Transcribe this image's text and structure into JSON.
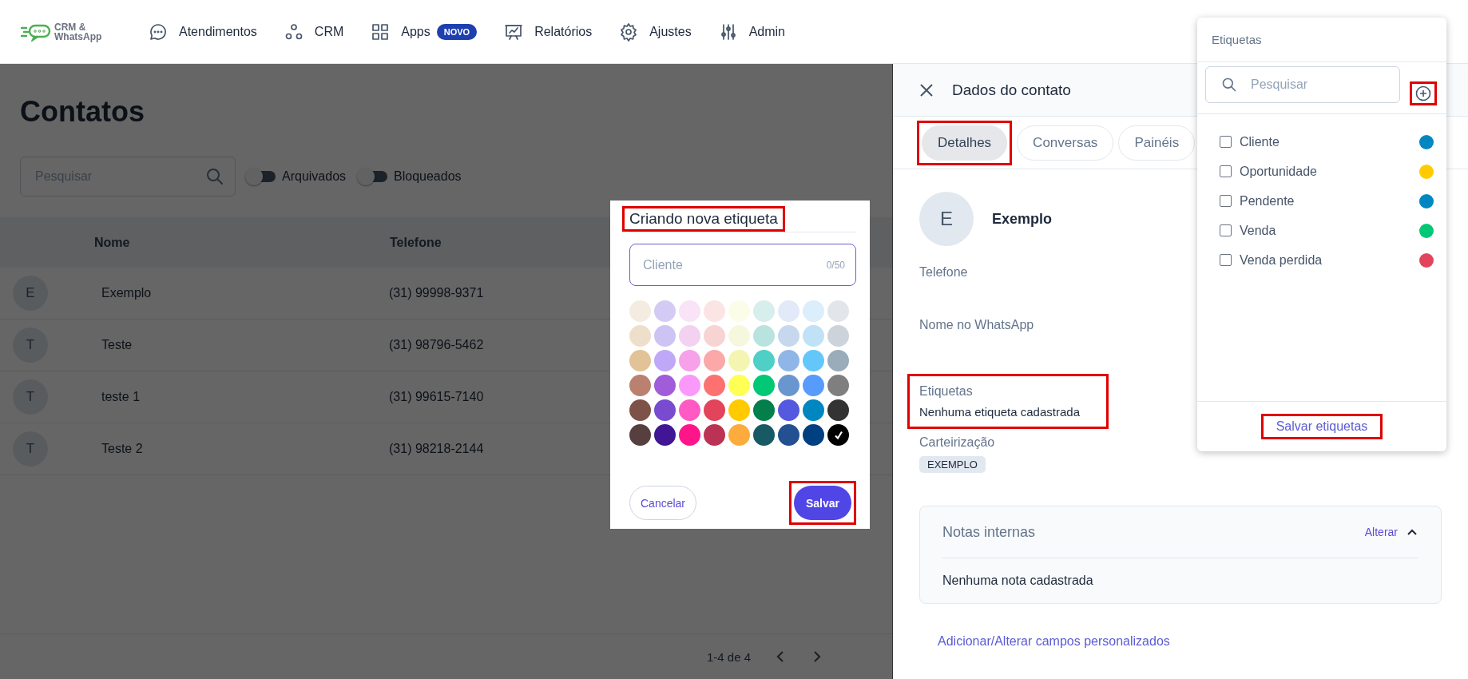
{
  "brand": {
    "logo_text": "CRM & WhatsApp"
  },
  "nav": [
    {
      "kind": "chat",
      "label": "Atendimentos"
    },
    {
      "kind": "circles",
      "label": "CRM"
    },
    {
      "kind": "grid",
      "label": "Apps",
      "badge": "NOVO"
    },
    {
      "kind": "presentation",
      "label": "Relatórios"
    },
    {
      "kind": "gear",
      "label": "Ajustes"
    },
    {
      "kind": "sliders",
      "label": "Admin"
    }
  ],
  "page": {
    "title": "Contatos",
    "search": {
      "placeholder": "Pesquisar"
    },
    "filters": [
      {
        "label": "Arquivados",
        "on": false
      },
      {
        "label": "Bloqueados",
        "on": false
      }
    ],
    "table": {
      "columns": [
        "Nome",
        "Telefone"
      ],
      "rows": [
        {
          "initial": "E",
          "name": "Exemplo",
          "phone": "(31) 99998-9371"
        },
        {
          "initial": "T",
          "name": "Teste",
          "phone": "(31) 98796-5462"
        },
        {
          "initial": "T",
          "name": "teste 1",
          "phone": "(31) 99615-7140"
        },
        {
          "initial": "T",
          "name": "Teste 2",
          "phone": "(31) 98218-2144"
        }
      ]
    },
    "pagination": {
      "range": "1-4 de 4"
    }
  },
  "drawer": {
    "title": "Dados do contato",
    "tabs": [
      {
        "label": "Detalhes",
        "selected": true,
        "highlighted": true
      },
      {
        "label": "Conversas",
        "selected": false,
        "highlighted": false
      },
      {
        "label": "Painéis",
        "selected": false,
        "highlighted": false
      }
    ],
    "contact": {
      "initial": "E",
      "name": "Exemplo"
    },
    "fields": [
      {
        "label": "Telefone",
        "highlighted": false
      },
      {
        "label": "Nome no WhatsApp",
        "highlighted": false
      },
      {
        "label": "Etiquetas",
        "value": "Nenhuma etiqueta cadastrada",
        "highlighted": true
      },
      {
        "label": "Carteirização",
        "chip": "EXEMPLO",
        "highlighted": false
      }
    ],
    "notes": {
      "title": "Notas internas",
      "action": "Alterar",
      "expanded": true,
      "empty_text": "Nenhuma nota cadastrada"
    },
    "custom_fields_link": "Adicionar/Alterar campos personalizados"
  },
  "modal": {
    "title": "Criando nova etiqueta",
    "title_highlighted": true,
    "name_field": {
      "placeholder": "Cliente",
      "counter": "0/50"
    },
    "swatches": [
      {
        "color": "#f4ece1",
        "selected": false
      },
      {
        "color": "#d4cbf5",
        "selected": false
      },
      {
        "color": "#f8e3f7",
        "selected": false
      },
      {
        "color": "#fbe4e4",
        "selected": false
      },
      {
        "color": "#fbfde8",
        "selected": false
      },
      {
        "color": "#d6eeec",
        "selected": false
      },
      {
        "color": "#e2e9f8",
        "selected": false
      },
      {
        "color": "#dcedfb",
        "selected": false
      },
      {
        "color": "#e2e6ea",
        "selected": false
      },
      {
        "color": "#eedfcb",
        "selected": false
      },
      {
        "color": "#cdc4f4",
        "selected": false
      },
      {
        "color": "#f3d1f0",
        "selected": false
      },
      {
        "color": "#f7d3d3",
        "selected": false
      },
      {
        "color": "#f6f8de",
        "selected": false
      },
      {
        "color": "#b9e3df",
        "selected": false
      },
      {
        "color": "#c7d7ee",
        "selected": false
      },
      {
        "color": "#bfe2f7",
        "selected": false
      },
      {
        "color": "#cdd3db",
        "selected": false
      },
      {
        "color": "#e2c297",
        "selected": false
      },
      {
        "color": "#bfa8f8",
        "selected": false
      },
      {
        "color": "#f6a1ea",
        "selected": false
      },
      {
        "color": "#fba8a8",
        "selected": false
      },
      {
        "color": "#f4f5b0",
        "selected": false
      },
      {
        "color": "#4fcfc6",
        "selected": false
      },
      {
        "color": "#8fb6e7",
        "selected": false
      },
      {
        "color": "#64c7fb",
        "selected": false
      },
      {
        "color": "#9aabb9",
        "selected": false
      },
      {
        "color": "#bb8170",
        "selected": false
      },
      {
        "color": "#a05cd9",
        "selected": false
      },
      {
        "color": "#fb99fb",
        "selected": false
      },
      {
        "color": "#fd7171",
        "selected": false
      },
      {
        "color": "#ffff55",
        "selected": false
      },
      {
        "color": "#00c875",
        "selected": false
      },
      {
        "color": "#6a96d0",
        "selected": false
      },
      {
        "color": "#579bfc",
        "selected": false
      },
      {
        "color": "#7f7f7f",
        "selected": false
      },
      {
        "color": "#7d5249",
        "selected": false
      },
      {
        "color": "#784bd1",
        "selected": false
      },
      {
        "color": "#ff5ac4",
        "selected": false
      },
      {
        "color": "#e2445c",
        "selected": false
      },
      {
        "color": "#ffcb00",
        "selected": false
      },
      {
        "color": "#037f4c",
        "selected": false
      },
      {
        "color": "#5559df",
        "selected": false
      },
      {
        "color": "#0086c0",
        "selected": false
      },
      {
        "color": "#333333",
        "selected": false
      },
      {
        "color": "#573f3f",
        "selected": false
      },
      {
        "color": "#401694",
        "selected": false
      },
      {
        "color": "#ff158a",
        "selected": false
      },
      {
        "color": "#bb3354",
        "selected": false
      },
      {
        "color": "#fdab3d",
        "selected": false
      },
      {
        "color": "#175a63",
        "selected": false
      },
      {
        "color": "#225091",
        "selected": false
      },
      {
        "color": "#003f80",
        "selected": false
      },
      {
        "color": "#000000",
        "selected": true
      }
    ],
    "buttons": [
      {
        "kind": "secondary",
        "label": "Cancelar",
        "highlighted": false
      },
      {
        "kind": "primary",
        "label": "Salvar",
        "highlighted": true
      }
    ]
  },
  "tag_menu": {
    "title": "Etiquetas",
    "search": {
      "placeholder": "Pesquisar"
    },
    "add_highlighted": true,
    "tags": [
      {
        "label": "Cliente",
        "checked": false,
        "color": "#0086c0"
      },
      {
        "label": "Oportunidade",
        "checked": false,
        "color": "#ffcb00"
      },
      {
        "label": "Pendente",
        "checked": false,
        "color": "#0086c0"
      },
      {
        "label": "Venda",
        "checked": false,
        "color": "#00c875"
      },
      {
        "label": "Venda perdida",
        "checked": false,
        "color": "#e2445c"
      }
    ],
    "save_label": "Salvar etiquetas",
    "save_highlighted": true
  }
}
